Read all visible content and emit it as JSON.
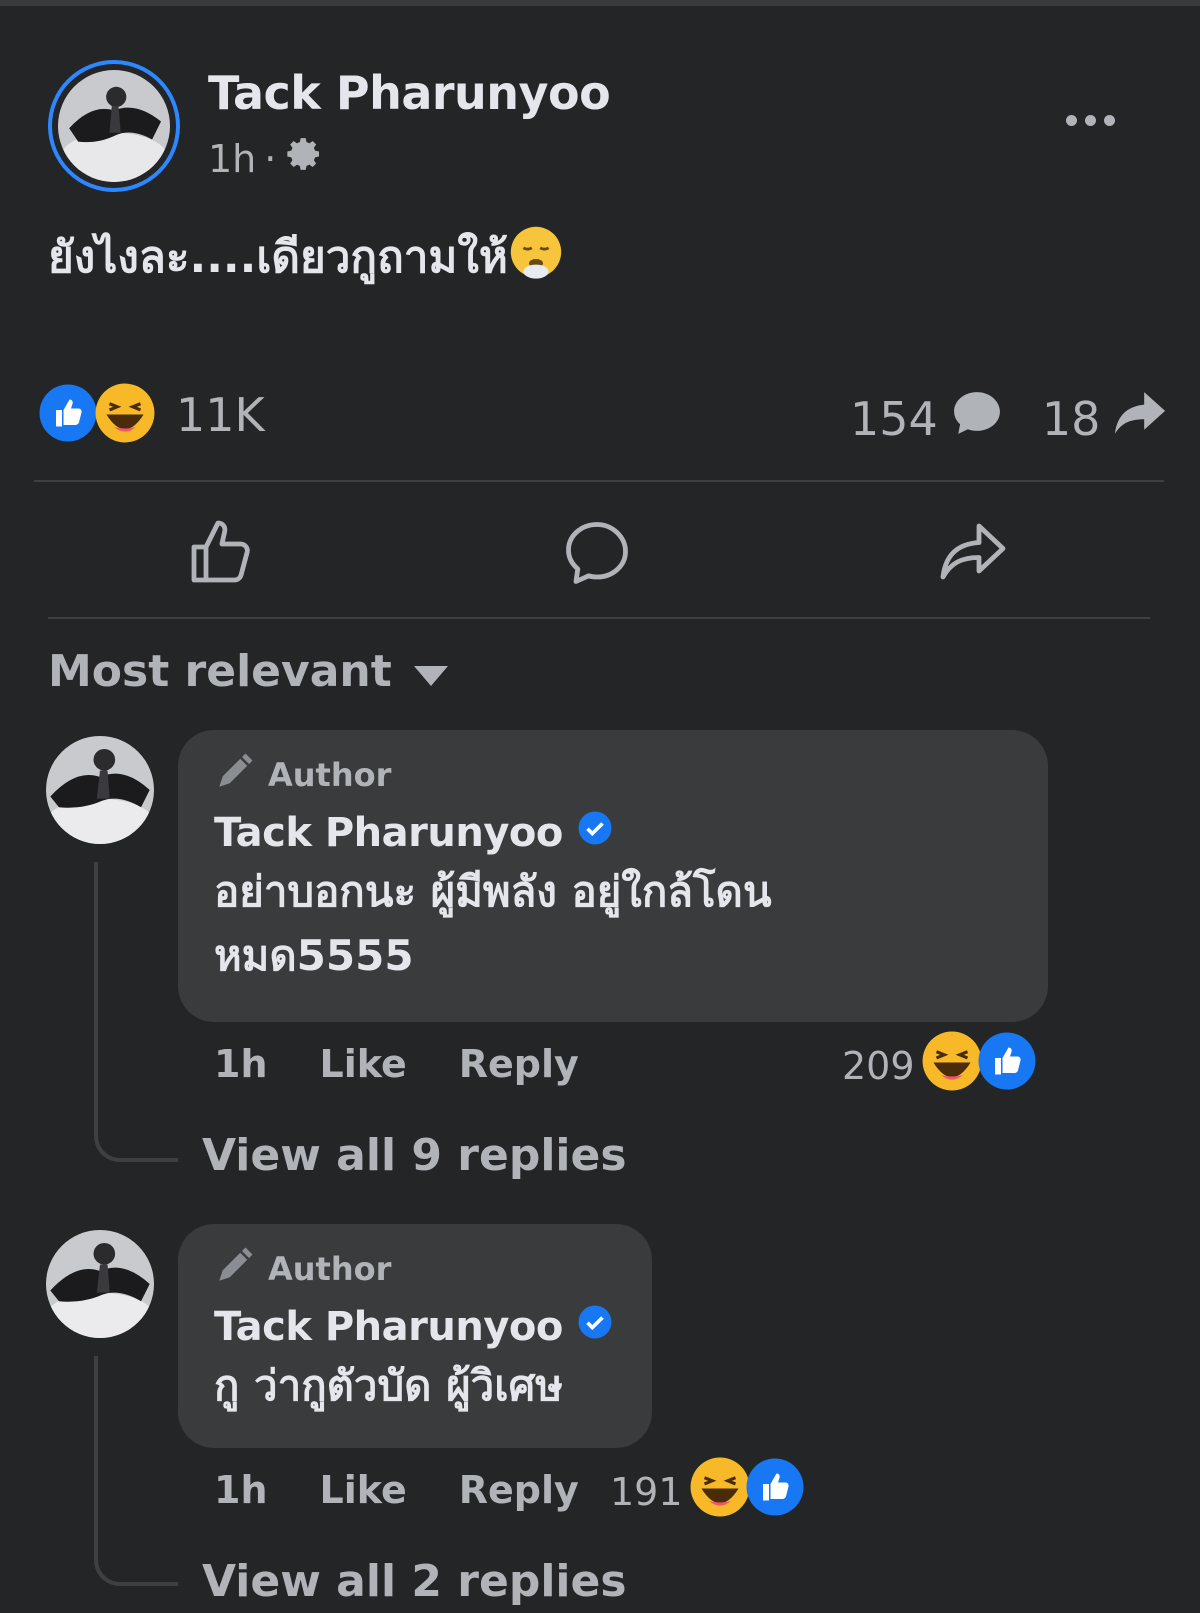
{
  "post": {
    "author": "Tack Pharunyoo",
    "time": "1h",
    "separator": "·",
    "text": "ยังไงละ....เดียวกูถามให้",
    "reactions_count": "11K",
    "comments_count": "154",
    "shares_count": "18"
  },
  "sort": {
    "label": "Most relevant"
  },
  "comments": [
    {
      "tag": "Author",
      "name": "Tack Pharunyoo",
      "text_line1": "อย่าบอกนะ ผู้มีพลัง อยู่ใกล้โดน",
      "text_line2": "หมด5555",
      "time": "1h",
      "like": "Like",
      "reply": "Reply",
      "reactions": "209",
      "view_replies": "View all 9 replies"
    },
    {
      "tag": "Author",
      "name": "Tack Pharunyoo",
      "text_line1": "กู ว่ากูตัวบัด ผู้วิเศษ",
      "time": "1h",
      "like": "Like",
      "reply": "Reply",
      "reactions": "191",
      "view_replies": "View all 2 replies"
    }
  ],
  "colors": {
    "background": "#242526",
    "bubble": "#3a3b3c",
    "accent": "#2d88ff",
    "text": "#e4e6eb",
    "muted": "#b0b3b8"
  },
  "icons": [
    "gear-icon",
    "more-icon",
    "like-reaction-icon",
    "haha-reaction-icon",
    "comment-icon",
    "share-icon",
    "like-icon",
    "pen-icon",
    "verified-icon",
    "caret-down-icon"
  ]
}
